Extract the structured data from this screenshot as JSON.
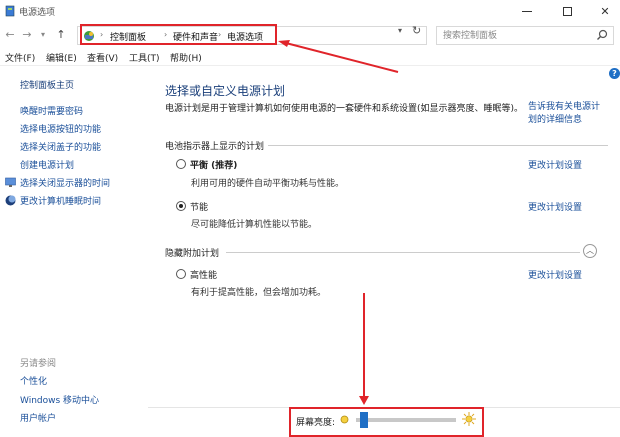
{
  "window": {
    "title": "电源选项"
  },
  "address": {
    "breadcrumbs": [
      "控制面板",
      "硬件和声音",
      "电源选项"
    ],
    "search_placeholder": "搜索控制面板"
  },
  "menu": [
    "文件(F)",
    "编辑(E)",
    "查看(V)",
    "工具(T)",
    "帮助(H)"
  ],
  "sidebar": {
    "home": "控制面板主页",
    "links": [
      "唤醒时需要密码",
      "选择电源按钮的功能",
      "选择关闭盖子的功能",
      "创建电源计划",
      "选择关闭显示器的时间",
      "更改计算机睡眠时间"
    ],
    "see_also_title": "另请参阅",
    "see_also": [
      "个性化",
      "Windows 移动中心",
      "用户帐户"
    ]
  },
  "main": {
    "title": "选择或自定义电源计划",
    "description": "电源计划是用于管理计算机如何使用电源的一套硬件和系统设置(如显示器亮度、睡眠等)。",
    "desc_link": "告诉我有关电源计划的详细信息",
    "group1": "电池指示器上显示的计划",
    "group2": "隐藏附加计划",
    "plans": [
      {
        "name": "平衡 (推荐)",
        "desc": "利用可用的硬件自动平衡功耗与性能。",
        "link": "更改计划设置",
        "selected": false
      },
      {
        "name": "节能",
        "desc": "尽可能降低计算机性能以节能。",
        "link": "更改计划设置",
        "selected": true
      },
      {
        "name": "高性能",
        "desc": "有利于提高性能，但会增加功耗。",
        "link": "更改计划设置",
        "selected": false
      }
    ]
  },
  "brightness": {
    "label": "屏幕亮度:",
    "level": 0.04
  },
  "colors": {
    "accent": "#1f6fc5",
    "link": "#1a4f99",
    "highlight": "#e0242a"
  }
}
